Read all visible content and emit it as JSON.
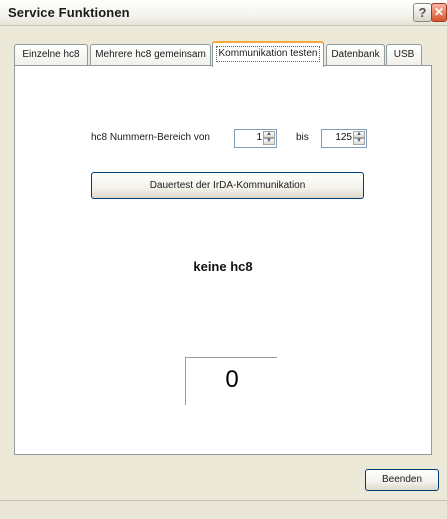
{
  "window": {
    "title": "Service Funktionen",
    "help_glyph": "?",
    "close_glyph": "✕"
  },
  "tabs": [
    {
      "label": "Einzelne hc8",
      "active": false
    },
    {
      "label": "Mehrere hc8 gemeinsam",
      "active": false
    },
    {
      "label": "Kommunikation testen",
      "active": true
    },
    {
      "label": "Datenbank",
      "active": false
    },
    {
      "label": "USB",
      "active": false
    }
  ],
  "range": {
    "label": "hc8 Nummern-Bereich von",
    "from_value": "1",
    "separator": "bis",
    "to_value": "125"
  },
  "actions": {
    "test_button": "Dauertest der IrDA-Kommunikation",
    "close_button": "Beenden"
  },
  "status": {
    "message": "keine hc8",
    "counter": "0"
  },
  "icons": {
    "spin_up": "spin-up-icon",
    "spin_down": "spin-down-icon",
    "help": "help-icon",
    "close": "close-icon"
  }
}
